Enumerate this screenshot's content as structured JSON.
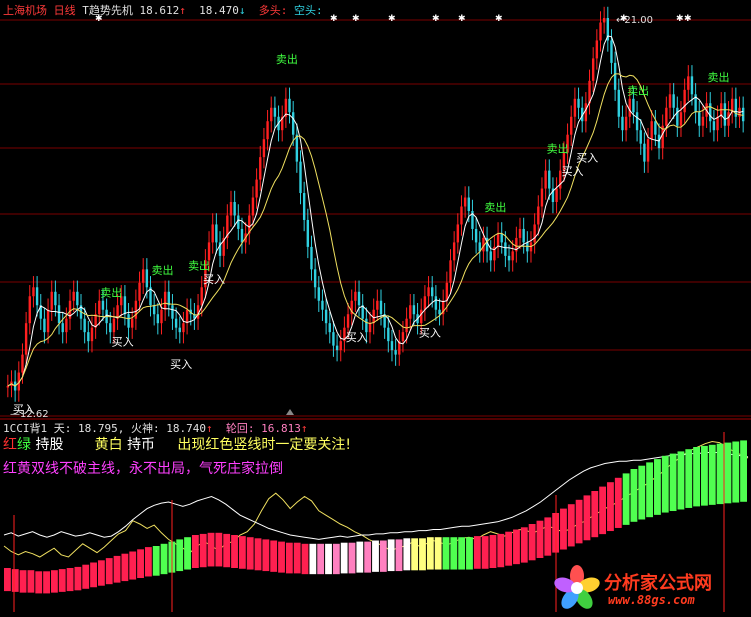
{
  "header": {
    "stock": "上海机场",
    "period": "日线",
    "indicator": "T趋势先机",
    "v1": "18.612",
    "v2": "18.470",
    "long_label": "多头:",
    "short_label": "空头:"
  },
  "subheader": {
    "name": "1CCI背1",
    "tian_label": "天:",
    "tian_value": "18.795,",
    "huo_label": "火神:",
    "huo_value": "18.740",
    "lun_label": "轮回:",
    "lun_value": "16.813"
  },
  "legend": {
    "red": "红",
    "green": "绿",
    "hold_stock": "持股",
    "yellow_white": "黄白",
    "hold_cash": "持币",
    "warning": "出现红色竖线时一定要关注!",
    "line2": "红黄双线不破主线，永不出局，气死庄家拉倒"
  },
  "colors": {
    "up": "#ff2020",
    "down": "#30d0e0",
    "ma_fast": "#ffffff",
    "ma_slow": "#f0e060",
    "buy_text": "#ffffff",
    "sell_text": "#40ff40",
    "grid": "#7a0000",
    "ribbon_red": "#ff2050",
    "ribbon_green": "#50ff50",
    "ribbon_white": "#ffffff",
    "ribbon_pink": "#ff80c0",
    "ribbon_yellow": "#ffff80"
  },
  "watermark": {
    "brand": "分析家公式网",
    "url": "www.88gs.com"
  },
  "chart_data": [
    {
      "type": "candlestick",
      "title": "上海机场 日线",
      "low_label": "12.62",
      "high_label": "21.00",
      "signals": {
        "buy": "买入",
        "sell": "卖出"
      },
      "close": [
        12.8,
        12.9,
        12.7,
        13.1,
        13.5,
        14.2,
        14.8,
        15.0,
        14.6,
        14.3,
        14.0,
        14.5,
        14.9,
        14.6,
        14.2,
        14.0,
        14.3,
        14.7,
        14.9,
        14.6,
        14.3,
        14.0,
        13.8,
        14.1,
        14.4,
        14.7,
        14.5,
        14.2,
        14.0,
        14.3,
        14.6,
        14.8,
        14.4,
        14.1,
        14.3,
        14.7,
        15.1,
        15.4,
        15.0,
        14.6,
        14.4,
        14.2,
        14.5,
        14.9,
        14.6,
        14.3,
        14.1,
        14.0,
        14.2,
        14.5,
        14.4,
        14.3,
        14.6,
        15.0,
        15.6,
        16.0,
        16.4,
        16.0,
        15.7,
        16.1,
        16.6,
        16.9,
        16.6,
        16.3,
        16.0,
        16.2,
        16.6,
        17.0,
        17.4,
        17.9,
        18.3,
        18.7,
        19.0,
        18.8,
        18.5,
        18.8,
        19.2,
        18.9,
        18.4,
        17.8,
        17.1,
        16.5,
        15.9,
        15.4,
        15.0,
        14.7,
        14.5,
        14.2,
        14.0,
        13.7,
        13.6,
        13.8,
        14.1,
        14.4,
        14.7,
        14.9,
        14.6,
        14.3,
        14.0,
        14.2,
        14.5,
        14.7,
        14.4,
        14.1,
        13.8,
        13.6,
        13.5,
        13.8,
        14.0,
        14.3,
        14.6,
        14.4,
        14.2,
        14.5,
        14.8,
        15.0,
        14.8,
        14.5,
        14.4,
        14.7,
        15.1,
        15.6,
        16.0,
        16.4,
        16.8,
        17.0,
        16.7,
        16.3,
        16.0,
        15.8,
        16.1,
        15.8,
        15.6,
        15.9,
        16.2,
        16.0,
        15.7,
        15.6,
        15.8,
        16.1,
        16.3,
        16.0,
        15.8,
        16.0,
        16.4,
        16.8,
        17.2,
        17.6,
        17.2,
        16.9,
        17.2,
        17.6,
        18.0,
        18.4,
        18.8,
        19.2,
        19.0,
        18.7,
        19.1,
        19.6,
        20.1,
        20.5,
        20.9,
        21.0,
        20.5,
        20.0,
        19.4,
        18.8,
        18.5,
        18.8,
        19.2,
        18.9,
        18.5,
        18.2,
        17.8,
        18.3,
        18.7,
        18.4,
        18.1,
        18.6,
        19.0,
        19.3,
        19.0,
        18.6,
        18.9,
        19.4,
        19.7,
        19.3,
        18.9,
        18.6,
        18.8,
        19.1,
        18.7,
        18.5,
        18.8,
        19.1,
        18.6,
        18.9,
        19.2,
        18.8,
        19.0,
        18.7
      ]
    },
    {
      "type": "line",
      "title": "1CCI背1",
      "series": [
        {
          "name": "天",
          "values": [
            16.0,
            15.5,
            15.2,
            15.5,
            15.3,
            15.0,
            15.4,
            15.8,
            15.2,
            15.0,
            15.6,
            16.2,
            15.8,
            15.4,
            15.9,
            16.5,
            17.1,
            17.4,
            18.3,
            18.0,
            17.6,
            17.9,
            17.2,
            16.6,
            16.2,
            15.8,
            15.4,
            16.0,
            16.4,
            16.0,
            15.6,
            16.2,
            16.4,
            17.0,
            17.3,
            18.0,
            19.2,
            20.3,
            20.8,
            20.2,
            19.4,
            20.0,
            20.5,
            20.1,
            19.2,
            18.8,
            18.4,
            18.0,
            17.7,
            17.3,
            17.0,
            16.6,
            16.3,
            16.0,
            15.6,
            15.8,
            16.0,
            16.3,
            16.0,
            16.2,
            16.5,
            16.3,
            16.1,
            16.4,
            16.7,
            16.8,
            16.6,
            17.0,
            17.3,
            17.1,
            16.9,
            17.2,
            17.5,
            17.4,
            17.2,
            17.5,
            17.8,
            17.6,
            17.3,
            17.5,
            17.9,
            18.2,
            18.6,
            19.0,
            19.4,
            19.7,
            20.1,
            20.5,
            20.9,
            21.3,
            21.7,
            22.2,
            22.7,
            23.3,
            23.8,
            24.3,
            24.7,
            25.0,
            25.3,
            25.5,
            25.4,
            25.0,
            24.6,
            24.3,
            24.0
          ]
        },
        {
          "name": "火神",
          "values": [
            17.0,
            17.2,
            16.9,
            17.1,
            17.3,
            17.0,
            16.8,
            17.0,
            17.3,
            17.1,
            16.9,
            17.0,
            17.2,
            17.0,
            16.8,
            16.9,
            17.3,
            17.8,
            18.4,
            18.9,
            19.4,
            19.7,
            19.9,
            20.0,
            19.8,
            19.6,
            19.8,
            20.1,
            20.3,
            20.5,
            20.2,
            19.8,
            19.3,
            18.8,
            18.5,
            18.2,
            17.9,
            17.6,
            17.4,
            17.2,
            17.0,
            16.9,
            16.8,
            16.7,
            16.6,
            16.7,
            16.8,
            16.9,
            16.8,
            16.9,
            17.0,
            17.0,
            17.1,
            17.1,
            17.2,
            17.2,
            17.3,
            17.3,
            17.4,
            17.4,
            17.5,
            17.5,
            17.6,
            17.7,
            17.8,
            17.8,
            17.9,
            18.0,
            18.1,
            18.2,
            18.4,
            18.6,
            18.9,
            19.2,
            19.6,
            20.0,
            20.5,
            21.0,
            21.5,
            22.0,
            22.4,
            22.8,
            23.1,
            23.3,
            23.5,
            23.6,
            23.7,
            23.7,
            23.8,
            23.8,
            23.9,
            24.0,
            24.1,
            24.2,
            24.3,
            24.3,
            24.4,
            24.4,
            24.5,
            24.5,
            24.5,
            24.4,
            24.3,
            24.2,
            24.1
          ]
        },
        {
          "name": "轮回",
          "values": [
            14.0,
            13.9,
            13.8,
            13.8,
            13.7,
            13.7,
            13.8,
            13.9,
            14.0,
            14.1,
            14.3,
            14.5,
            14.7,
            14.9,
            15.1,
            15.3,
            15.5,
            15.7,
            15.9,
            16.0,
            16.2,
            16.4,
            16.6,
            16.8,
            17.0,
            17.1,
            17.2,
            17.2,
            17.1,
            17.0,
            16.9,
            16.8,
            16.7,
            16.6,
            16.5,
            16.4,
            16.3,
            16.3,
            16.2,
            16.2,
            16.2,
            16.2,
            16.2,
            16.3,
            16.3,
            16.4,
            16.4,
            16.5,
            16.5,
            16.6,
            16.6,
            16.7,
            16.7,
            16.7,
            16.8,
            16.8,
            16.8,
            16.8,
            16.8,
            16.8,
            16.9,
            16.9,
            17.0,
            17.1,
            17.3,
            17.5,
            17.7,
            18.0,
            18.3,
            18.6,
            19.0,
            19.4,
            19.8,
            20.2,
            20.6,
            21.0,
            21.4,
            21.8,
            22.2,
            22.6,
            23.0,
            23.3,
            23.6,
            23.9,
            24.2,
            24.4,
            24.6,
            24.8,
            25.0,
            25.1,
            25.2,
            25.3,
            25.4,
            25.5,
            25.6
          ]
        }
      ]
    }
  ]
}
